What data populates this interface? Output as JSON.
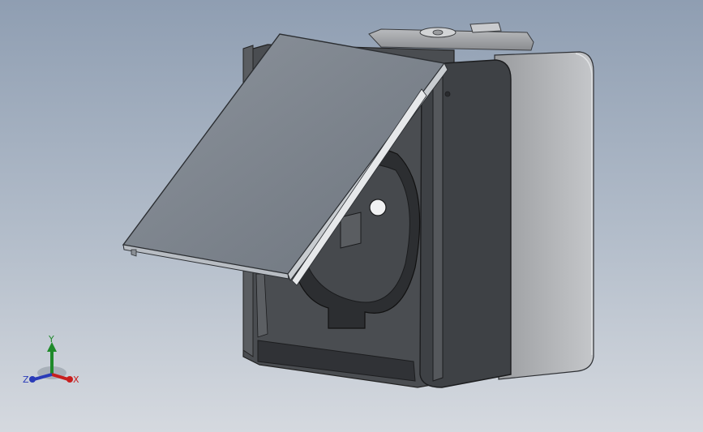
{
  "scene": {
    "background_top": "#8f9eb2",
    "background_bottom": "#d5d9df",
    "model_name": "outdoor-socket-with-hinged-lid"
  },
  "triad": {
    "x_label": "X",
    "y_label": "Y",
    "z_label": "Z",
    "x_color": "#c81e1e",
    "y_color": "#1f8a2a",
    "z_color": "#2a3bb8"
  }
}
